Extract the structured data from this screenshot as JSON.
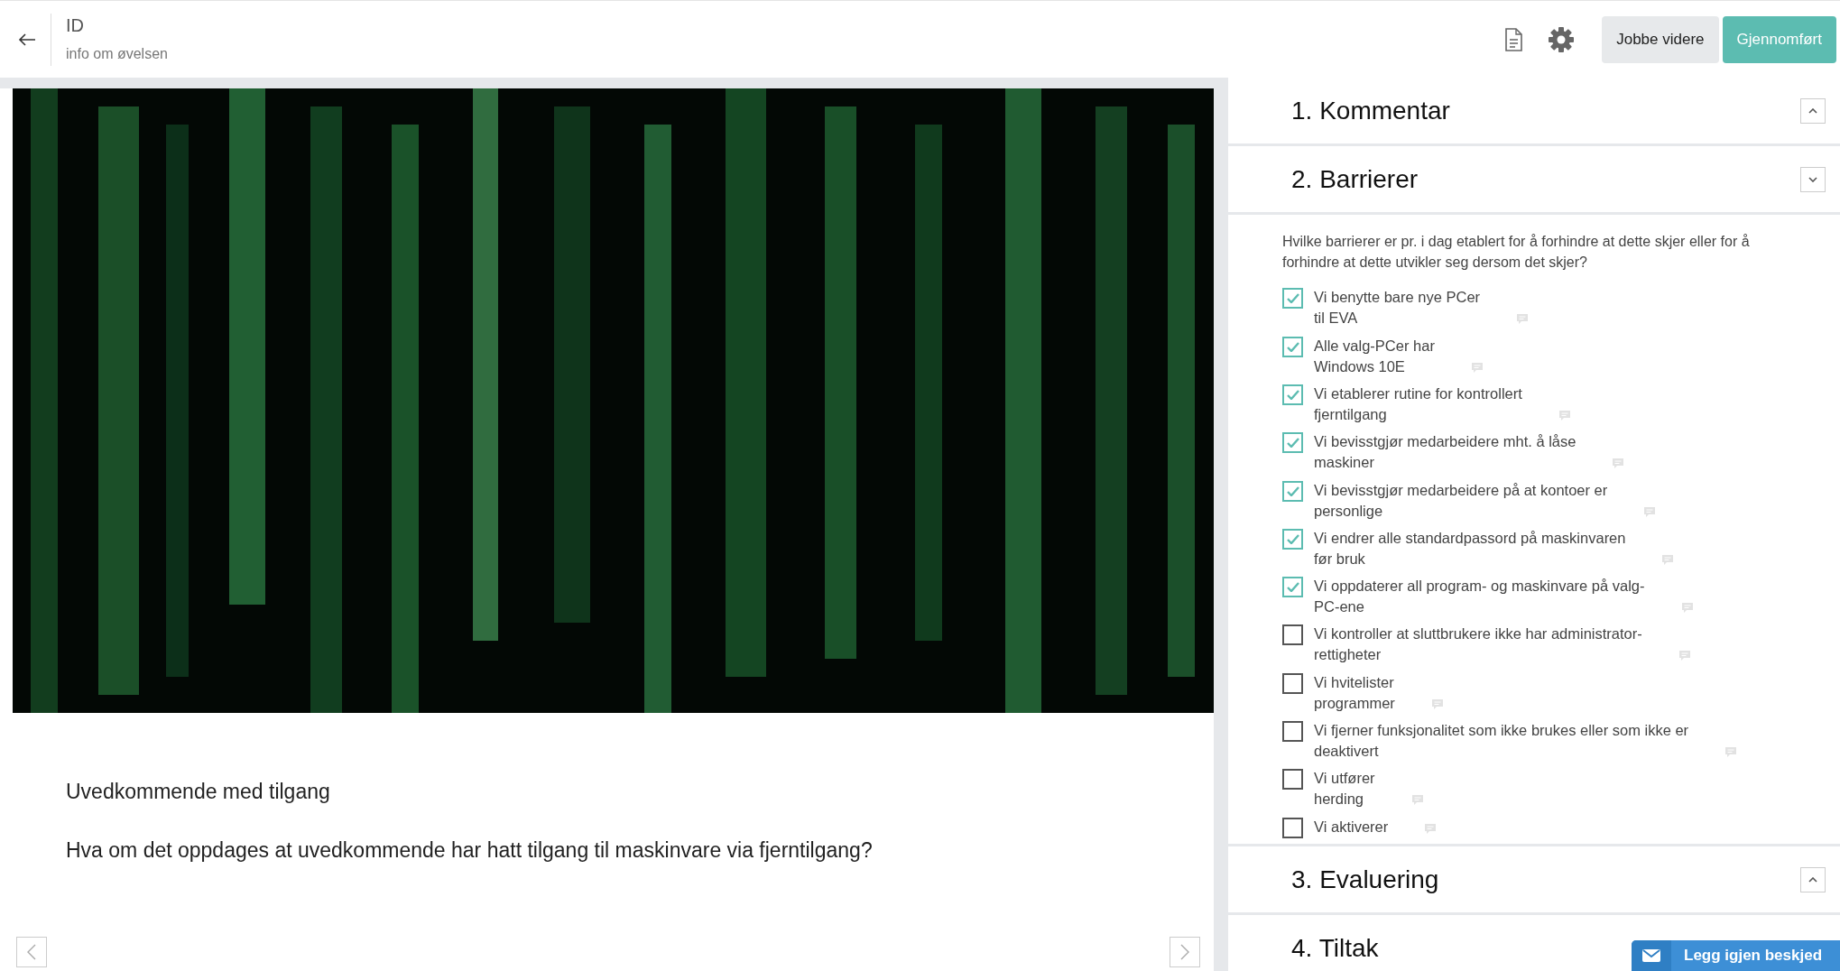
{
  "header": {
    "title": "ID",
    "subtitle": "info om øvelsen",
    "buttons": [
      {
        "label": "Jobbe videre",
        "kind": "secondary"
      },
      {
        "label": "Gjennomført",
        "kind": "primary"
      }
    ]
  },
  "scenario": {
    "kind": "picture",
    "title": "Uvedkommende med tilgang",
    "question": "Hva om det oppdages at uvedkommende har hatt tilgang til maskinvare via fjerntilgang?"
  },
  "sections": [
    {
      "title": "1. Kommentar",
      "expanded": false
    },
    {
      "title": "2. Barrierer",
      "expanded": true,
      "prompt": "Hvilke barrierer er pr. i dag etablert for å forhindre at dette skjer eller for å forhindre at dette utvikler seg dersom det skjer?",
      "items": [
        {
          "label": "Vi benytte bare nye PCer\ntil EVA",
          "checked": true
        },
        {
          "label": "Alle valg-PCer har\nWindows 10E",
          "checked": true
        },
        {
          "label": "Vi etablerer rutine for kontrollert\nfjerntilgang",
          "checked": true
        },
        {
          "label": "Vi bevisstgjør medarbeidere mht. å låse\nmaskiner",
          "checked": true
        },
        {
          "label": "Vi bevisstgjør medarbeidere på at kontoer er\npersonlige",
          "checked": true
        },
        {
          "label": "Vi endrer alle standardpassord på maskinvaren\nfør bruk",
          "checked": true
        },
        {
          "label": "Vi oppdaterer all program- og maskinvare på valg-\nPC-ene",
          "checked": true
        },
        {
          "label": "Vi kontroller at sluttbrukere ikke har administrator-\nrettigheter",
          "checked": false
        },
        {
          "label": "Vi hvitelister\nprogrammer",
          "checked": false
        },
        {
          "label": "Vi fjerner funksjonalitet som ikke brukes eller som ikke er\ndeaktivert",
          "checked": false
        },
        {
          "label": "Vi utfører\nherding",
          "checked": false
        },
        {
          "label": "Vi aktiverer",
          "checked": false
        }
      ]
    },
    {
      "title": "3. Evaluering",
      "expanded": false
    },
    {
      "title": "4. Tiltak"
    }
  ],
  "message_button": {
    "label": "Legg igjen beskjed"
  }
}
